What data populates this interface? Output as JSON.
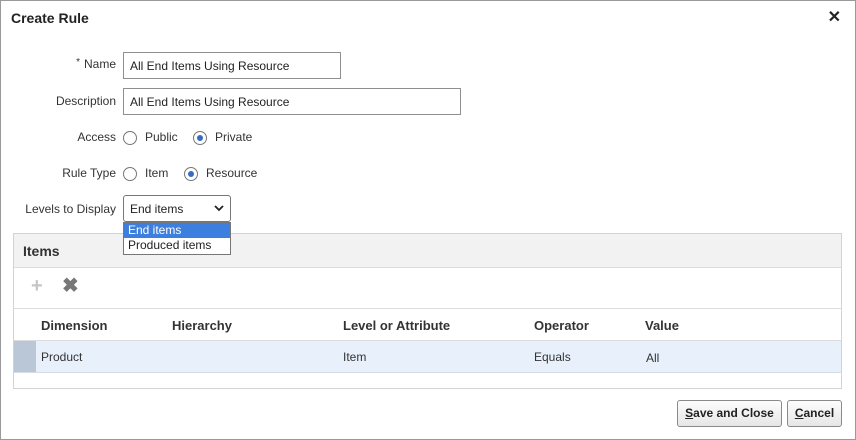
{
  "dialog": {
    "title": "Create Rule",
    "close_icon": "close-icon"
  },
  "form": {
    "required_marker": "*",
    "name_label": "Name",
    "name_value": "All End Items Using Resource",
    "description_label": "Description",
    "description_value": "All End Items Using Resource",
    "access_label": "Access",
    "access_options": [
      "Public",
      "Private"
    ],
    "access_selected": "Private",
    "rule_type_label": "Rule Type",
    "rule_type_options": [
      "Item",
      "Resource"
    ],
    "rule_type_selected": "Resource",
    "levels_label": "Levels to Display",
    "levels_value": "End items",
    "levels_options": [
      "End items",
      "Produced items"
    ]
  },
  "items_panel": {
    "title": "Items",
    "add_icon": "plus-icon",
    "delete_icon": "x-delete-icon",
    "columns": [
      "Dimension",
      "Hierarchy",
      "Level or Attribute",
      "Operator",
      "Value"
    ],
    "rows": [
      {
        "dimension": "Product",
        "hierarchy": "",
        "level": "Item",
        "operator": "Equals",
        "value": "All"
      }
    ]
  },
  "buttons": {
    "save_close_first": "S",
    "save_close_rest": "ave and Close",
    "cancel_first": "C",
    "cancel_rest": "ancel"
  },
  "colors": {
    "selected_option": "#3d7fde",
    "selected_row": "#e8f0fb",
    "radio_dot": "#3a6bc4"
  }
}
